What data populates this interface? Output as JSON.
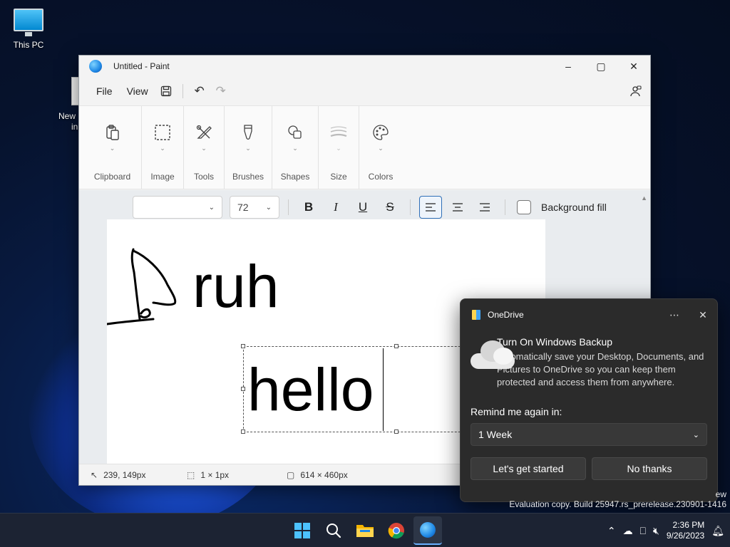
{
  "desktop": {
    "this_pc_label": "This PC",
    "partial_icon_label_line1": "New",
    "partial_icon_label_line2": "in"
  },
  "paint": {
    "title": "Untitled - Paint",
    "menu": {
      "file": "File",
      "view": "View"
    },
    "ribbon_groups": [
      {
        "label": "Clipboard",
        "icon": "clipboard-icon"
      },
      {
        "label": "Image",
        "icon": "selection-icon"
      },
      {
        "label": "Tools",
        "icon": "tools-icon"
      },
      {
        "label": "Brushes",
        "icon": "brush-icon"
      },
      {
        "label": "Shapes",
        "icon": "shapes-icon"
      },
      {
        "label": "Size",
        "icon": "size-icon",
        "disabled": true
      },
      {
        "label": "Colors",
        "icon": "palette-icon"
      }
    ],
    "text_toolbar": {
      "font_family": "",
      "font_size": "72",
      "bold": "B",
      "italic": "I",
      "underline": "U",
      "strikethrough": "S",
      "background_fill_label": "Background fill",
      "alignment": "left"
    },
    "canvas": {
      "text_ruh": "ruh",
      "text_hello": "hello"
    },
    "status": {
      "cursor_position": "239, 149px",
      "selection_size": "1 × 1px",
      "canvas_size": "614 × 460px"
    }
  },
  "onedrive_toast": {
    "app_name": "OneDrive",
    "title": "Turn On Windows Backup",
    "message": "Automatically save your Desktop, Documents, and Pictures to OneDrive so you can keep them protected and access them from anywhere.",
    "remind_label": "Remind me again in:",
    "remind_value": "1 Week",
    "primary_button": "Let's get started",
    "secondary_button": "No thanks"
  },
  "watermark": {
    "line1": "ew",
    "line2": "Evaluation copy. Build 25947.rs_prerelease.230901-1416"
  },
  "taskbar": {
    "time": "2:36 PM",
    "date": "9/26/2023"
  },
  "colors": {
    "accent": "#2f6fb7",
    "toast_bg": "#2b2b2b",
    "taskbar_bg": "#1c2333"
  }
}
